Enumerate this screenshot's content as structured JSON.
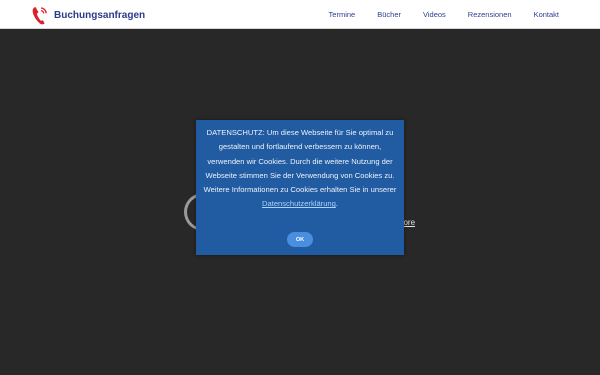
{
  "brand": {
    "name": "Buchungsanfragen",
    "icon": "phone-icon",
    "icon_color": "#d8232a"
  },
  "nav": {
    "links": [
      "Termine",
      "Bücher",
      "Videos",
      "Rezensionen",
      "Kontakt"
    ]
  },
  "background": {
    "loader_icon": "loading-spinner-icon",
    "more_link_fragment": "nore"
  },
  "cookie_notice": {
    "text_before": "DATENSCHUTZ: Um diese Webseite für Sie optimal zu gestalten und fortlaufend verbessern zu können, verwenden wir Cookies. Durch die weitere Nutzung der Webseite stimmen Sie der Verwendung von Cookies zu. Weitere Informationen zu Cookies erhalten Sie in unserer ",
    "link_text": "Datenschutzerklärung",
    "text_after": ".",
    "ok_label": "OK",
    "background_color": "#215ba1",
    "button_color": "#4a8ee0"
  }
}
